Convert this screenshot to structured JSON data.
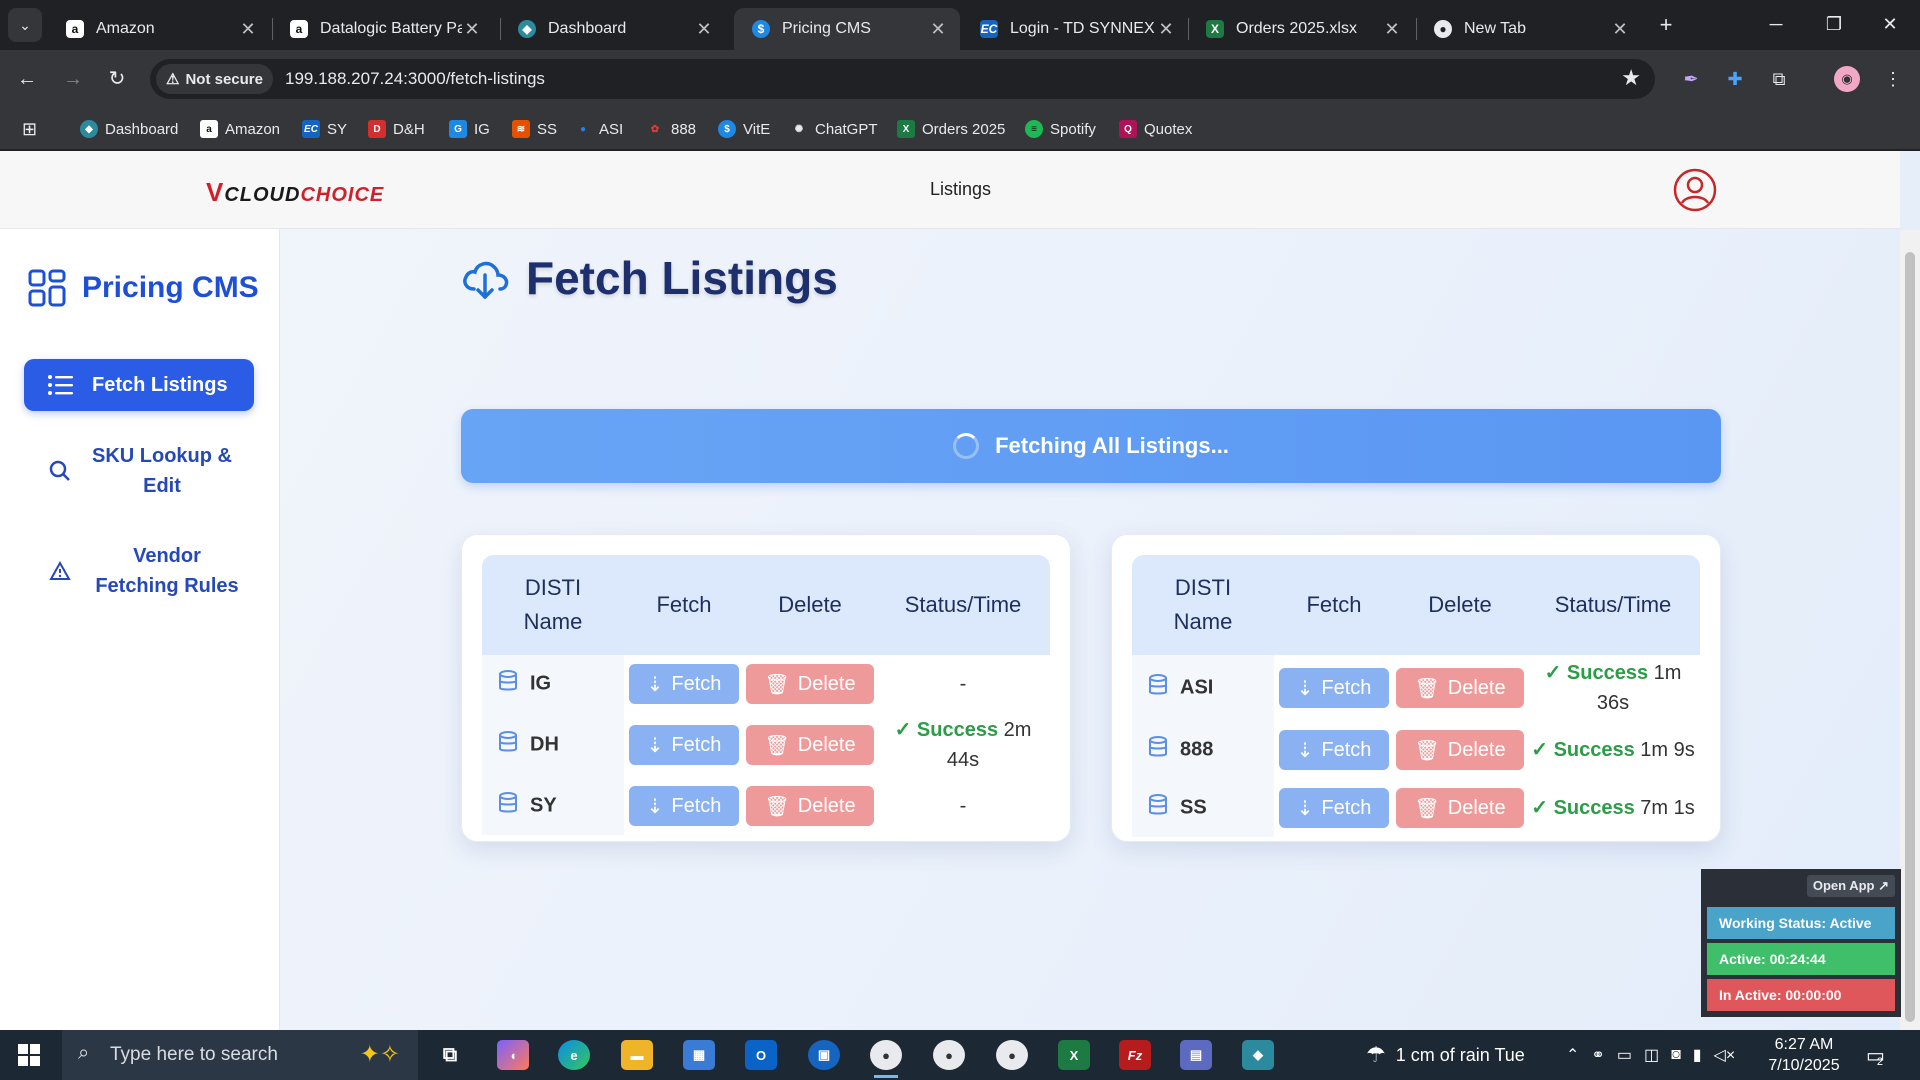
{
  "browser": {
    "tabs": [
      {
        "title": "Amazon",
        "icon": "amazon-icon",
        "active": false
      },
      {
        "title": "Datalogic Battery Pa",
        "icon": "amazon-icon",
        "active": false
      },
      {
        "title": "Dashboard",
        "icon": "dashboard-icon",
        "active": false
      },
      {
        "title": "Pricing CMS",
        "icon": "dollar-icon",
        "active": true
      },
      {
        "title": "Login - TD SYNNEX",
        "icon": "ec-icon",
        "active": false
      },
      {
        "title": "Orders 2025.xlsx",
        "icon": "excel-icon",
        "active": false
      },
      {
        "title": "New Tab",
        "icon": "chrome-icon",
        "active": false
      }
    ],
    "security": "Not secure",
    "url": "199.188.207.24:3000/fetch-listings",
    "bookmarks": [
      {
        "label": "Dashboard",
        "icon": "dashboard-icon"
      },
      {
        "label": "Amazon",
        "icon": "amazon-icon"
      },
      {
        "label": "SY",
        "icon": "ec-icon"
      },
      {
        "label": "D&H",
        "icon": "dh-icon"
      },
      {
        "label": "IG",
        "icon": "ig-icon"
      },
      {
        "label": "SS",
        "icon": "ss-icon"
      },
      {
        "label": "ASI",
        "icon": "asi-icon"
      },
      {
        "label": "888",
        "icon": "888-icon"
      },
      {
        "label": "VitE",
        "icon": "dollar-icon"
      },
      {
        "label": "ChatGPT",
        "icon": "chatgpt-icon"
      },
      {
        "label": "Orders 2025",
        "icon": "excel-icon"
      },
      {
        "label": "Spotify",
        "icon": "spotify-icon"
      },
      {
        "label": "Quotex",
        "icon": "quotex-icon"
      }
    ]
  },
  "app": {
    "logo": {
      "v": "V",
      "cloud": "CLOUD",
      "choice": "CHOICE"
    },
    "header_title": "Listings",
    "brand_title": "Pricing CMS",
    "nav": [
      {
        "label": "Fetch Listings",
        "icon": "list-icon",
        "active": true
      },
      {
        "label": "SKU Lookup & Edit",
        "icon": "search-icon",
        "active": false
      },
      {
        "label": "Vendor Fetching Rules",
        "icon": "warning-icon",
        "active": false
      }
    ],
    "page_title": "Fetch Listings",
    "fetch_all_label": "Fetching All Listings...",
    "table_headers": {
      "name": "DISTI Name",
      "fetch": "Fetch",
      "delete": "Delete",
      "status": "Status/Time"
    },
    "fetch_label": "Fetch",
    "delete_label": "Delete",
    "left_rows": [
      {
        "name": "IG",
        "status": "",
        "time": "-"
      },
      {
        "name": "DH",
        "status": "Success",
        "time": "2m 44s"
      },
      {
        "name": "SY",
        "status": "",
        "time": "-"
      }
    ],
    "right_rows": [
      {
        "name": "ASI",
        "status": "Success",
        "time": "1m 36s"
      },
      {
        "name": "888",
        "status": "Success",
        "time": "1m 9s"
      },
      {
        "name": "SS",
        "status": "Success",
        "time": "7m 1s"
      }
    ],
    "colors": {
      "primary": "#2b5ce6",
      "fetch": "#8ab2f2",
      "delete": "#ef9a9a",
      "success": "#2a9d46"
    }
  },
  "widget": {
    "open_app": "Open App ↗",
    "working_status": "Working Status: Active",
    "active": "Active: 00:24:44",
    "inactive": "In Active: 00:00:00"
  },
  "taskbar": {
    "search_placeholder": "Type here to search",
    "weather": "1 cm of rain Tue",
    "time": "6:27 AM",
    "date": "7/10/2025",
    "notifications": "2"
  }
}
